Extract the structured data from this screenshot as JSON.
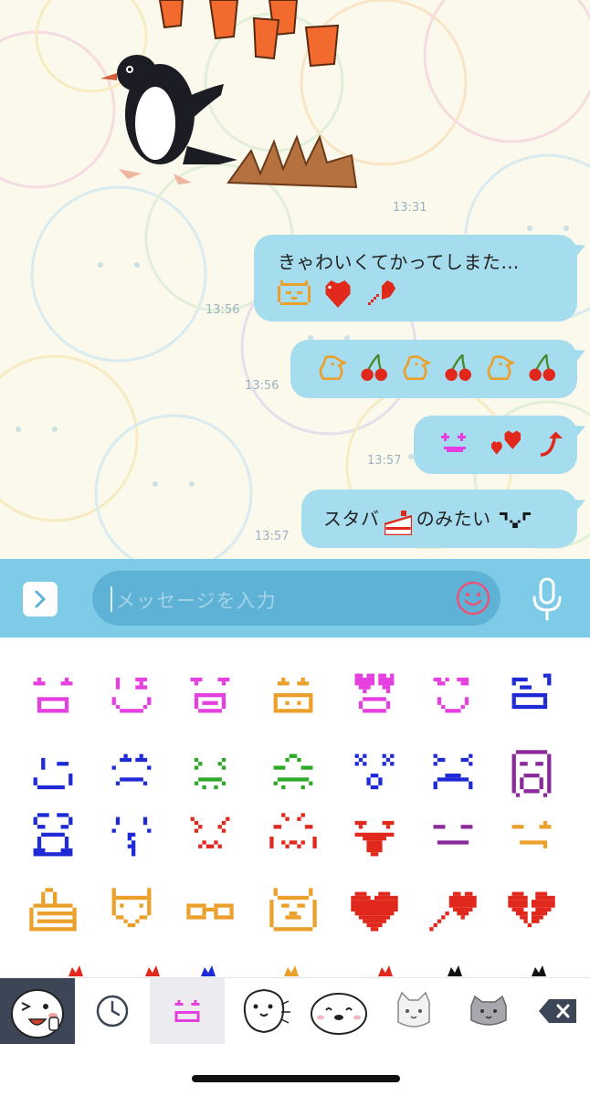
{
  "chat": {
    "timestamps": {
      "sticker": "13:31",
      "msg1": "13:56",
      "msg2": "13:56",
      "msg3": "13:57",
      "msg4": "13:57"
    },
    "messages": [
      {
        "text": "きゃわいくてかってしまた…",
        "emoji": [
          "cat-face-emoji",
          "heart-emoji",
          "arrow-heart-emoji"
        ]
      },
      {
        "emoji": [
          "chick-emoji",
          "cherry-emoji",
          "chick-emoji",
          "cherry-emoji",
          "chick-emoji",
          "cherry-emoji"
        ]
      },
      {
        "emoji": [
          "sparkle-eyes-emoji",
          "double-heart-emoji",
          "up-arrow-emoji"
        ]
      },
      {
        "text_before": "スタバ",
        "text_after": "のみたい",
        "emoji": [
          "cake-emoji",
          "smirk-face-emoji"
        ]
      }
    ]
  },
  "input": {
    "placeholder": "メッセージを入力"
  },
  "keyboard": {
    "tabs": [
      "profile-sticker-tab",
      "recent-icon",
      "emoji-tab",
      "seal-sticker-tab-1",
      "seal-sticker-tab-2",
      "cat-sticker-tab-1",
      "cat-sticker-tab-2",
      "delete-key"
    ],
    "selected_tab": "emoji-tab"
  },
  "colors": {
    "bubble": "#a6ddee",
    "input_bar": "#7dcbe6",
    "input_field": "#5db2d6",
    "emoji_pink": "#e63fe0",
    "emoji_blue": "#1d2ad6",
    "emoji_red": "#e0281c",
    "emoji_orange": "#eba02c"
  }
}
